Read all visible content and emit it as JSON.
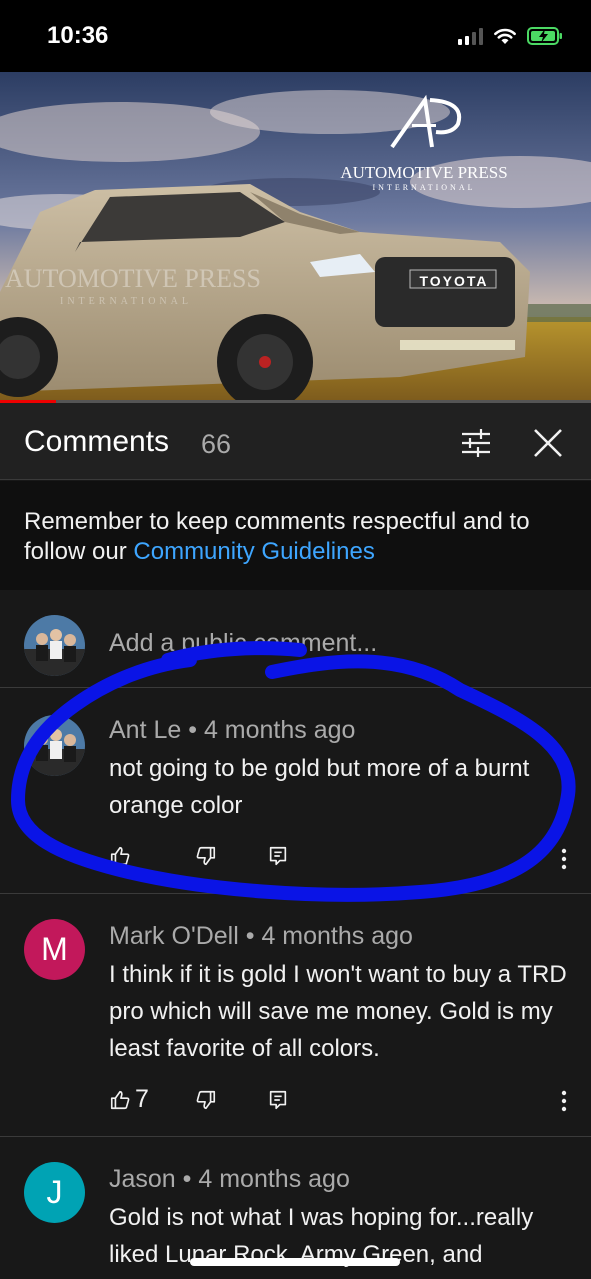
{
  "status_bar": {
    "time": "10:36"
  },
  "video": {
    "brand_name": "AUTOMOTIVE PRESS",
    "brand_sub": "INTERNATIONAL",
    "grille_badge": "TOYOTA",
    "watermark_main": "AUTOMOTIVE PRESS",
    "watermark_sub": "INTERNATIONAL"
  },
  "comments_panel": {
    "title": "Comments",
    "count": "66"
  },
  "guidelines": {
    "text": "Remember to keep comments respectful and to follow our ",
    "link": "Community Guidelines"
  },
  "add_comment": {
    "placeholder": "Add a public comment..."
  },
  "comments": [
    {
      "author": "Ant Le",
      "separator": " • ",
      "time": "4 months ago",
      "text": "not going to be gold but more of a burnt orange color",
      "likes": ""
    },
    {
      "author": "Mark O'Dell",
      "avatar_letter": "M",
      "avatar_color": "#c2185b",
      "separator": " • ",
      "time": "4 months ago",
      "text": "I think if it is gold I won't want to buy a TRD pro which will save me money. Gold is my least favorite of all colors.",
      "likes": "7"
    },
    {
      "author": "Jason",
      "avatar_letter": "J",
      "avatar_color": "#00a3b4",
      "separator": " • ",
      "time": "4 months ago",
      "text": "Gold is not what I was hoping for...really liked Lunar Rock, Army Green, and",
      "likes": ""
    }
  ],
  "colors": {
    "annotation": "#0a14e6",
    "link": "#3ea6ff",
    "progress": "#ee0000"
  }
}
